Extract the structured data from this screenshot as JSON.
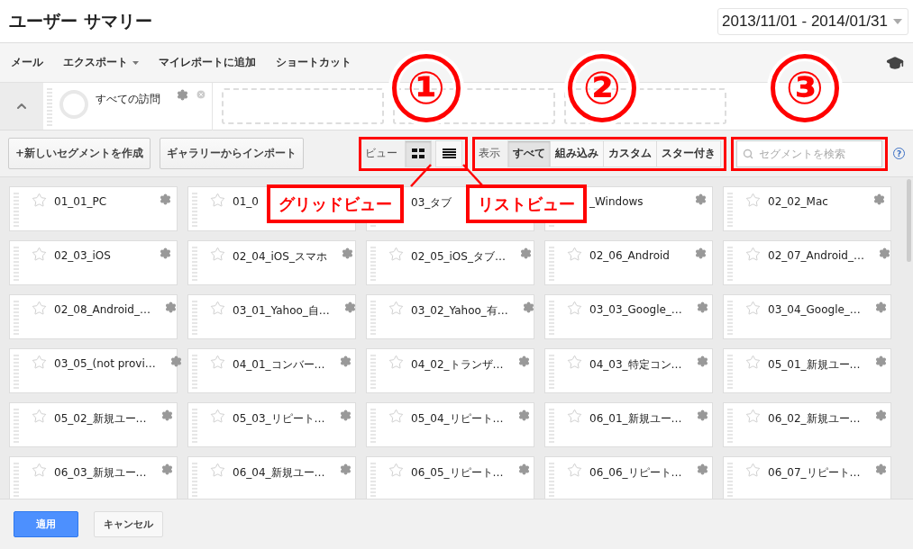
{
  "header": {
    "title": "ユーザー サマリー",
    "date_range": "2013/11/01 - 2014/01/31"
  },
  "toolbar": {
    "items": [
      {
        "label": "メール",
        "dropdown": false
      },
      {
        "label": "エクスポート",
        "dropdown": true
      },
      {
        "label": "マイレポートに追加",
        "dropdown": false
      },
      {
        "label": "ショートカット",
        "dropdown": false
      }
    ]
  },
  "segment_bar": {
    "expanded": true,
    "slots": [
      {
        "kind": "segment",
        "label": "すべての訪問"
      },
      {
        "kind": "empty"
      },
      {
        "kind": "empty"
      },
      {
        "kind": "empty"
      }
    ]
  },
  "actions": [
    {
      "label": "+新しいセグメントを作成"
    },
    {
      "label": "ギャラリーからインポート"
    }
  ],
  "view": {
    "label": "ビュー",
    "modes": [
      {
        "kind": "grid",
        "selected": true
      },
      {
        "kind": "list",
        "selected": false
      }
    ]
  },
  "filter": {
    "label": "表示",
    "options": [
      {
        "label": "すべて",
        "selected": true
      },
      {
        "label": "組み込み",
        "selected": false
      },
      {
        "label": "カスタム",
        "selected": false
      },
      {
        "label": "スター付き",
        "selected": false
      }
    ]
  },
  "search": {
    "placeholder": "セグメントを検索"
  },
  "help": "?",
  "segments": [
    {
      "label": "01_01_PC",
      "starred": false
    },
    {
      "label": "01_0",
      "starred": false
    },
    {
      "label": "03_タブ"
    },
    {
      "label": "_Windows"
    },
    {
      "label": "02_02_Mac",
      "starred": false
    },
    {
      "label": "02_03_iOS",
      "starred": false
    },
    {
      "label": "02_04_iOS_スマホ",
      "starred": false
    },
    {
      "label": "02_05_iOS_タブ…",
      "starred": false
    },
    {
      "label": "02_06_Android",
      "starred": false
    },
    {
      "label": "02_07_Android_…",
      "starred": false
    },
    {
      "label": "02_08_Android_…",
      "starred": false
    },
    {
      "label": "03_01_Yahoo_自…",
      "starred": false
    },
    {
      "label": "03_02_Yahoo_有…",
      "starred": false
    },
    {
      "label": "03_03_Google_…",
      "starred": false
    },
    {
      "label": "03_04_Google_…",
      "starred": false
    },
    {
      "label": "03_05_(not provi…",
      "starred": false
    },
    {
      "label": "04_01_コンバー…",
      "starred": false
    },
    {
      "label": "04_02_トランザ…",
      "starred": false
    },
    {
      "label": "04_03_特定コン…",
      "starred": false
    },
    {
      "label": "05_01_新規ユー…",
      "starred": false
    },
    {
      "label": "05_02_新規ユー…",
      "starred": false
    },
    {
      "label": "05_03_リピート…",
      "starred": false
    },
    {
      "label": "05_04_リピート…",
      "starred": false
    },
    {
      "label": "06_01_新規ユー…",
      "starred": false
    },
    {
      "label": "06_02_新規ユー…",
      "starred": false
    },
    {
      "label": "06_03_新規ユー…",
      "starred": false
    },
    {
      "label": "06_04_新規ユー…",
      "starred": false
    },
    {
      "label": "06_05_リピート…",
      "starred": false
    },
    {
      "label": "06_06_リピート…",
      "starred": false
    },
    {
      "label": "06_07_リピート…",
      "starred": false
    }
  ],
  "footer": {
    "buttons": [
      {
        "label": "適用",
        "kind": "primary"
      },
      {
        "label": "キャンセル",
        "kind": "secondary"
      }
    ]
  },
  "annotations": {
    "markers": [
      "①",
      "②",
      "③"
    ],
    "callouts": [
      "グリッドビュー",
      "リストビュー"
    ]
  }
}
